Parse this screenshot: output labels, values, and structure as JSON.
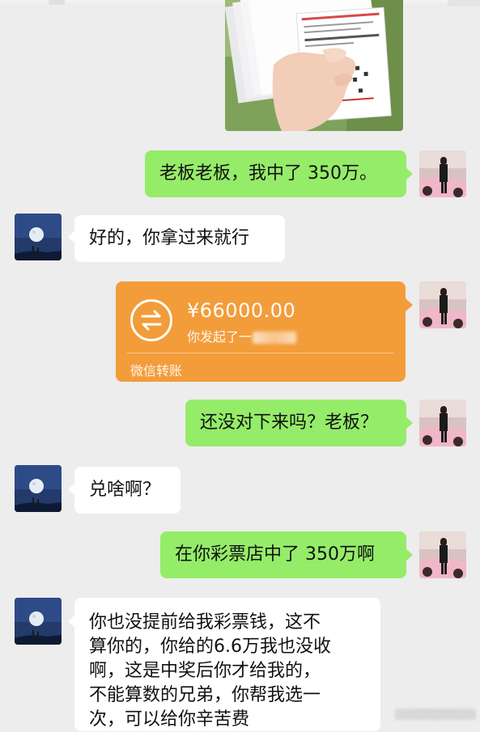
{
  "chat": {
    "messages": [
      {
        "sender": "me",
        "type": "image",
        "description_label": ""
      },
      {
        "sender": "me",
        "type": "text",
        "text": "老板老板，我中了 350万。"
      },
      {
        "sender": "other",
        "type": "text",
        "text": "好的，你拿过来就行"
      },
      {
        "sender": "me",
        "type": "transfer",
        "amount": "¥66000.00",
        "desc": "你发起了一",
        "footer": "微信转账"
      },
      {
        "sender": "me",
        "type": "text",
        "text": "还没对下来吗？老板？"
      },
      {
        "sender": "other",
        "type": "text",
        "text": "兑啥啊？"
      },
      {
        "sender": "me",
        "type": "text",
        "text": "在你彩票店中了 350万啊"
      },
      {
        "sender": "other",
        "type": "text",
        "lines": [
          "你也没提前给我彩票钱，这不",
          "算你的，你给的6.6万我也没收",
          "啊，这是中奖后你才给我的，",
          "不能算数的兄弟，你帮我选一",
          "次，可以给你辛苦费"
        ]
      }
    ]
  },
  "colors": {
    "background": "#ededed",
    "self_bubble": "#95ec69",
    "other_bubble": "#ffffff",
    "transfer_card": "#f39c3a"
  },
  "icons": {
    "self_avatar": "avatar-woman-with-pink-car",
    "other_avatar": "avatar-night-moon",
    "transfer_icon": "exchange-arrows-icon"
  }
}
